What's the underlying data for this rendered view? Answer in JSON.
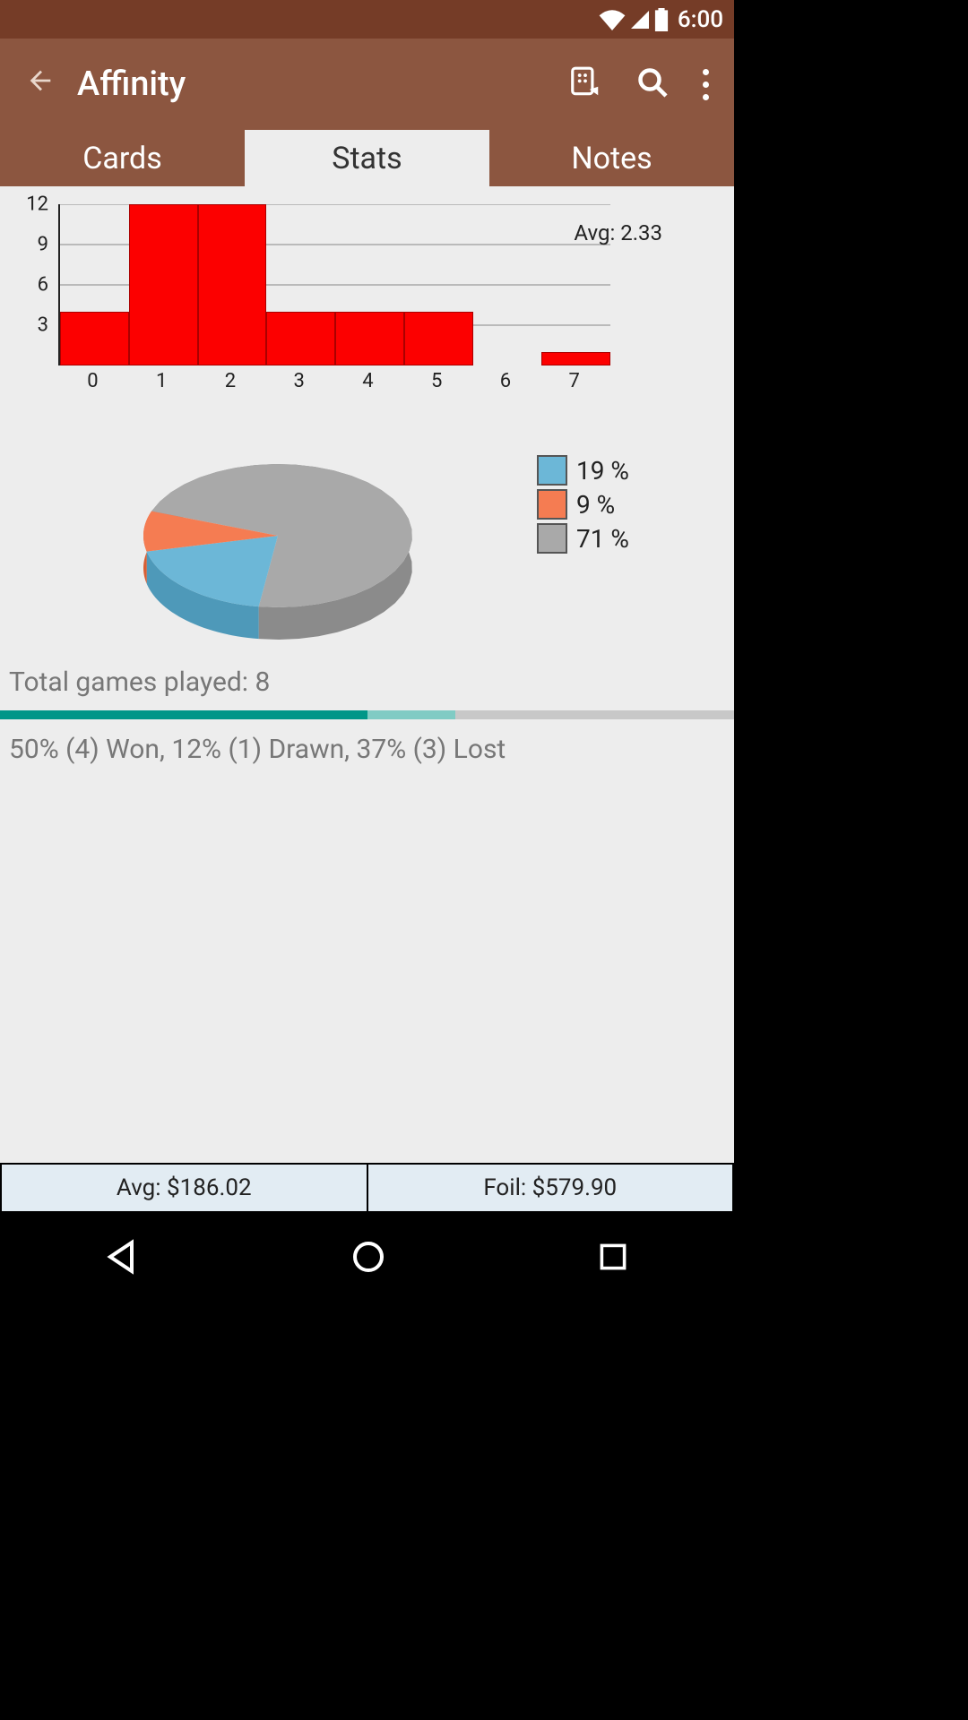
{
  "statusbar": {
    "time": "6:00"
  },
  "appbar": {
    "title": "Affinity"
  },
  "tabs": {
    "cards": "Cards",
    "stats": "Stats",
    "notes": "Notes",
    "active": "stats"
  },
  "chart_data": [
    {
      "type": "bar",
      "categories": [
        "0",
        "1",
        "2",
        "3",
        "4",
        "5",
        "6",
        "7"
      ],
      "values": [
        4,
        12,
        12,
        4,
        4,
        4,
        0,
        1
      ],
      "ylim": [
        0,
        12
      ],
      "y_ticks": [
        3,
        6,
        9,
        12
      ],
      "annotation": "Avg: 2.33",
      "color": "#fc0000"
    },
    {
      "type": "pie",
      "series": [
        {
          "name": "blue",
          "value": 19,
          "label": "19 %",
          "color": "#6cb7d7"
        },
        {
          "name": "orange",
          "value": 9,
          "label": "9 %",
          "color": "#f57c52"
        },
        {
          "name": "grey",
          "value": 71,
          "label": "71 %",
          "color": "#a9a9a9"
        }
      ]
    }
  ],
  "games": {
    "total_label": "Total games played: 8",
    "breakdown": "50% (4) Won, 12% (1) Drawn, 37% (3) Lost",
    "won_pct": 50,
    "drawn_pct": 12,
    "lost_pct": 37
  },
  "prices": {
    "avg": "Avg: $186.02",
    "foil": "Foil: $579.90"
  }
}
